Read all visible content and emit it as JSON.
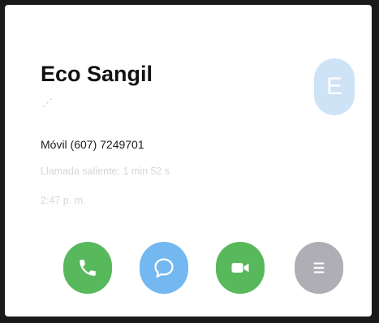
{
  "contact": {
    "name": "Eco Sangil",
    "sub_glyph": "⋰",
    "avatar_letter": "E",
    "phone": "Móvil (607) 7249701",
    "call_info": "Llamada saliente: 1 min 52 s",
    "time": "2:47 p. m."
  },
  "actions": [
    {
      "name": "call",
      "icon": "phone-icon",
      "color": "#58b85c"
    },
    {
      "name": "message",
      "icon": "message-bubble-icon",
      "color": "#73b8f0"
    },
    {
      "name": "video",
      "icon": "video-camera-icon",
      "color": "#58b85c"
    },
    {
      "name": "details",
      "icon": "list-icon",
      "color": "#aeaeb4"
    }
  ],
  "colors": {
    "avatar_bg": "#cfe3f7",
    "muted_text": "#d6d6d6"
  }
}
